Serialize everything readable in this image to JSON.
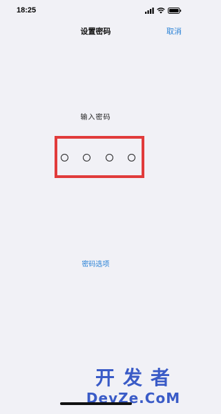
{
  "status_bar": {
    "time": "18:25",
    "icons": [
      "signal-icon",
      "wifi-icon",
      "battery-icon"
    ]
  },
  "nav": {
    "title": "设置密码",
    "cancel_label": "取消"
  },
  "passcode": {
    "prompt": "输入密码",
    "digit_count": 4,
    "entered": 0
  },
  "options_link": "密码选项",
  "annotation": {
    "color": "#e13b3b"
  },
  "watermark": {
    "line1": "开发者",
    "line2": "DevZe.CoM",
    "color": "#3a5bc7"
  },
  "colors": {
    "background": "#f1f1f6",
    "accent": "#2a82d6"
  }
}
